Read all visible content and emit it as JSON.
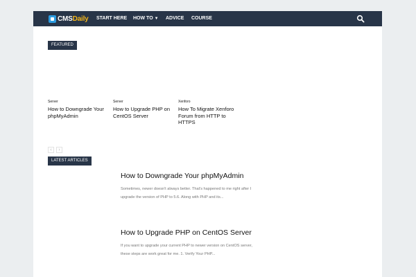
{
  "header": {
    "logo_prefix": "CMS",
    "logo_accent": "Daily",
    "nav": [
      {
        "label": "START HERE"
      },
      {
        "label": "HOW TO"
      },
      {
        "label": "ADVICE"
      },
      {
        "label": "COURSE"
      }
    ],
    "search_icon": "search-icon"
  },
  "featured": {
    "label": "FEATURED",
    "cards": [
      {
        "category": "Server",
        "title": "How to Downgrade Your phpMyAdmin"
      },
      {
        "category": "Server",
        "title": "How to Upgrade PHP on CentOS Server"
      },
      {
        "category": "Xenforo",
        "title": "How To Migrate Xenforo Forum from HTTP to HTTPS"
      }
    ],
    "pager": {
      "prev": "‹",
      "next": "›"
    }
  },
  "latest": {
    "label": "LATEST ARTICLES",
    "articles": [
      {
        "title": "How to Downgrade Your phpMyAdmin",
        "excerpt": "Sometimes, newer doesn't always better. That's happened to me right after I upgrade the version of PHP to 5.6. Along with PHP and its..."
      },
      {
        "title": "How to Upgrade PHP on CentOS Server",
        "excerpt": "If you want to upgrade your current PHP to newer version on CentOS server, these steps are work great for me.   1. Verify Your PHP..."
      }
    ]
  },
  "colors": {
    "navbar": "#283548",
    "logo_mark": "#2c9be0",
    "logo_accent": "#f3b51b",
    "page_bg": "#ebeef0"
  }
}
